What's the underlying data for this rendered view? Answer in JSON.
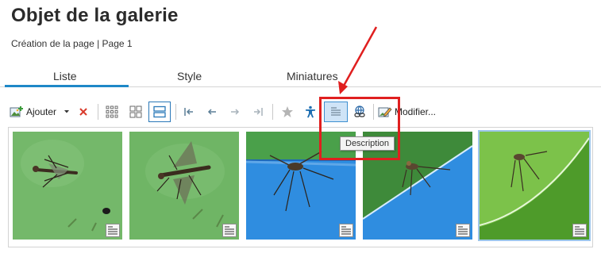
{
  "page": {
    "title": "Objet de la galerie",
    "subtitle": "Création de la page | Page 1"
  },
  "tabs": [
    {
      "label": "Liste",
      "active": true
    },
    {
      "label": "Style",
      "active": false
    },
    {
      "label": "Miniatures",
      "active": false
    }
  ],
  "toolbar": {
    "add_label": "Ajouter",
    "edit_label": "Modifier...",
    "buttons": [
      "add",
      "dropdown",
      "delete",
      "view-large-grid",
      "view-small-grid",
      "view-list",
      "first",
      "previous",
      "next",
      "last",
      "star",
      "accessibility",
      "description",
      "link",
      "edit"
    ]
  },
  "tooltip": {
    "text": "Description"
  },
  "gallery": {
    "items": [
      {
        "icon": "description-badge-icon",
        "selected": false
      },
      {
        "icon": "description-badge-icon",
        "selected": false
      },
      {
        "icon": "description-badge-icon",
        "selected": false
      },
      {
        "icon": "description-badge-icon",
        "selected": false
      },
      {
        "icon": "description-badge-icon",
        "selected": true
      }
    ]
  },
  "colors": {
    "accent": "#1e88c7",
    "annotation": "#e01f1f",
    "pressed": "#cfe4f7",
    "delete": "#d93a2b"
  }
}
